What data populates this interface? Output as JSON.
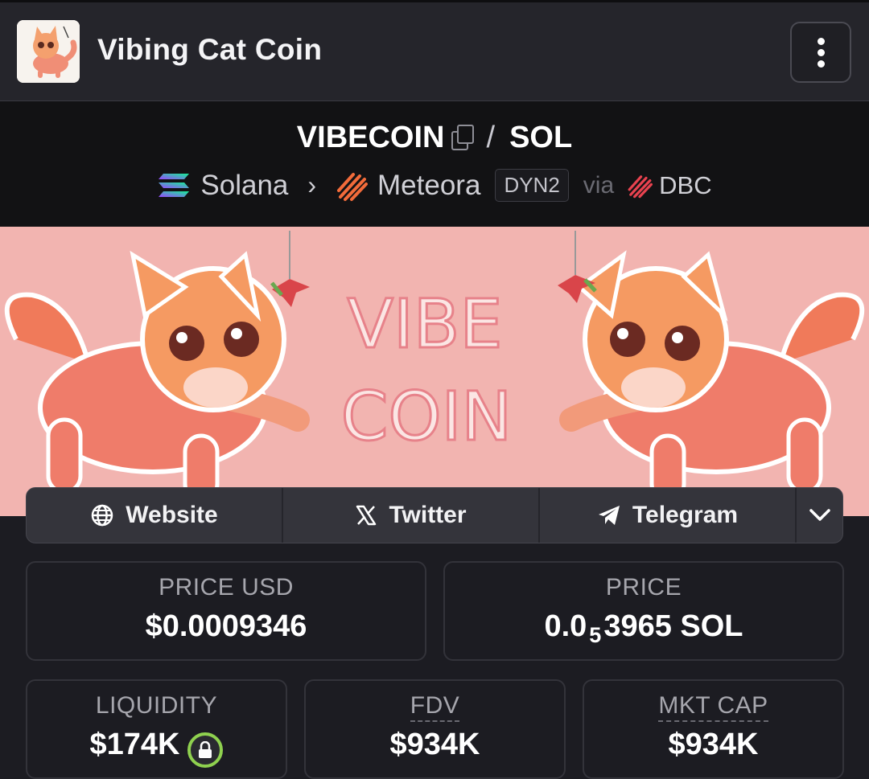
{
  "header": {
    "title": "Vibing Cat Coin",
    "menu_icon": "kebab-menu-icon"
  },
  "pair": {
    "base": "VIBECOIN",
    "separator": "/",
    "quote": "SOL"
  },
  "route": {
    "chain": "Solana",
    "dex": "Meteora",
    "pool_type": "DYN2",
    "via": "via",
    "launchpad": "DBC"
  },
  "banner": {
    "line1": "VIBE",
    "line2": "COIN"
  },
  "links": {
    "website": "Website",
    "twitter": "Twitter",
    "telegram": "Telegram"
  },
  "stats": {
    "price_usd_label": "PRICE USD",
    "price_usd_value": "$0.0009346",
    "price_label": "PRICE",
    "price_prefix": "0.0",
    "price_zeros": "5",
    "price_digits": "3965 SOL",
    "liquidity_label": "LIQUIDITY",
    "liquidity_value": "$174K",
    "fdv_label": "FDV",
    "fdv_value": "$934K",
    "mktcap_label": "MKT CAP",
    "mktcap_value": "$934K"
  },
  "colors": {
    "background": "#1c1c22",
    "banner": "#f2b6b2",
    "lock_ring": "#8fd14f"
  }
}
